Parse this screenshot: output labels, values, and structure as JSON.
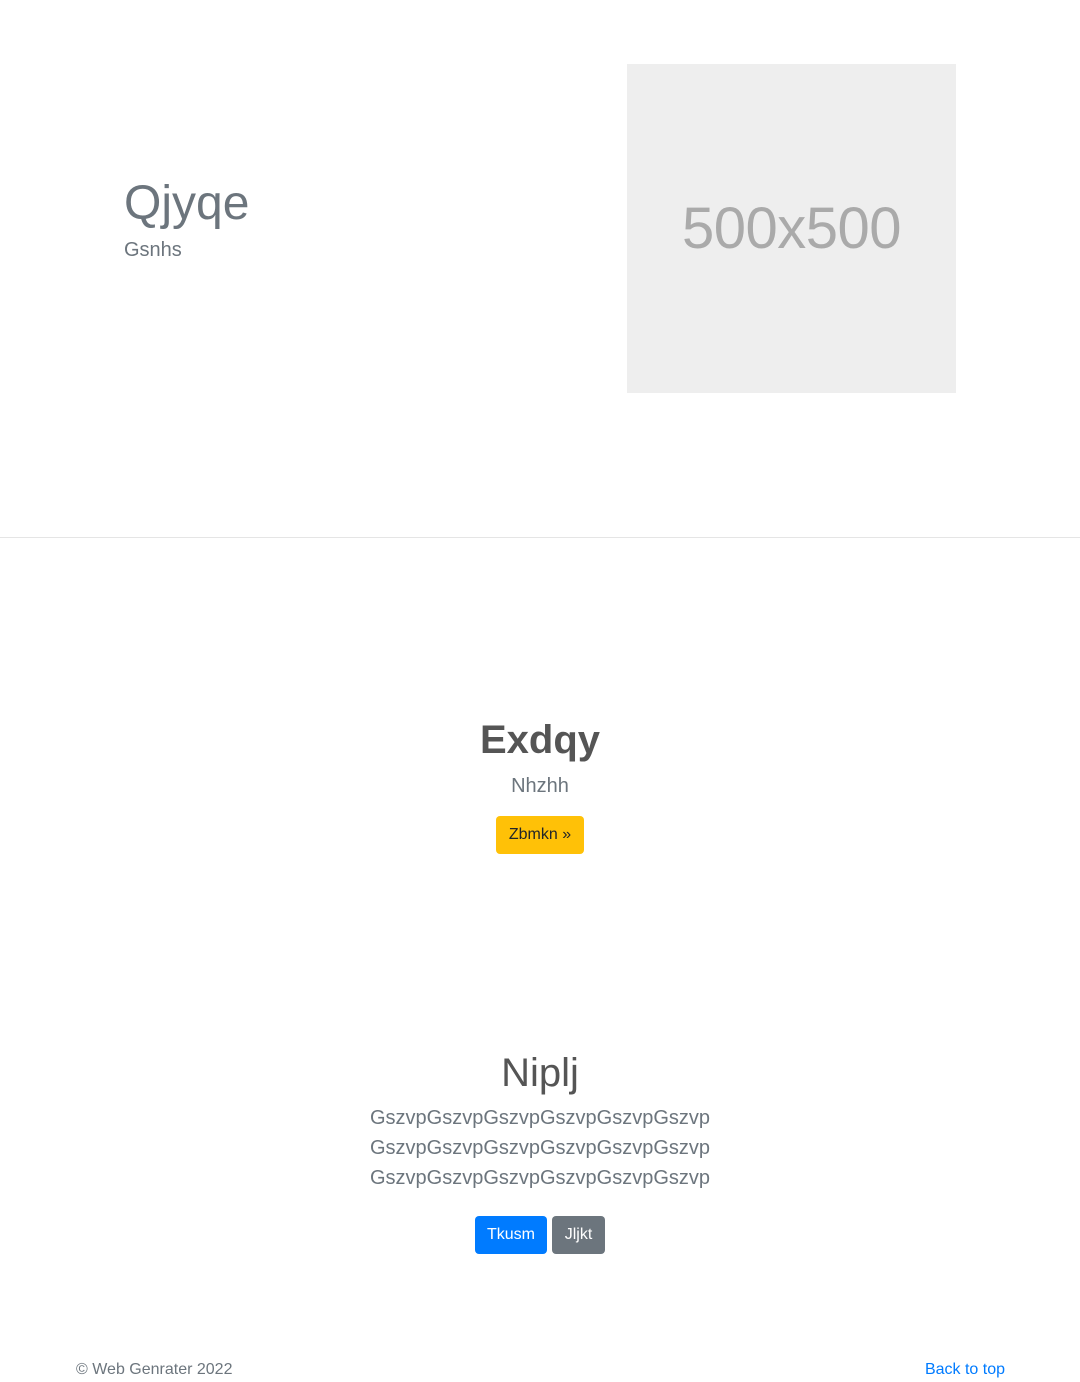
{
  "hero": {
    "title": "Qjyqe",
    "subtitle": "Gsnhs",
    "image_label": "500x500"
  },
  "cta": {
    "title": "Exdqy",
    "subtitle": "Nhzhh",
    "button_label": "Zbmkn »"
  },
  "jumbotron": {
    "title": "Niplj",
    "lines": [
      "GszvpGszvpGszvpGszvpGszvpGszvp",
      "GszvpGszvpGszvpGszvpGszvpGszvp",
      "GszvpGszvpGszvpGszvpGszvpGszvp"
    ],
    "primary_button": "Tkusm",
    "secondary_button": "Jljkt"
  },
  "footer": {
    "copyright": "© Web Genrater 2022",
    "back_to_top": "Back to top"
  },
  "colors": {
    "primary": "#007bff",
    "secondary": "#6c757d",
    "warning": "#ffc107",
    "placeholder_bg": "#eeeeee"
  }
}
